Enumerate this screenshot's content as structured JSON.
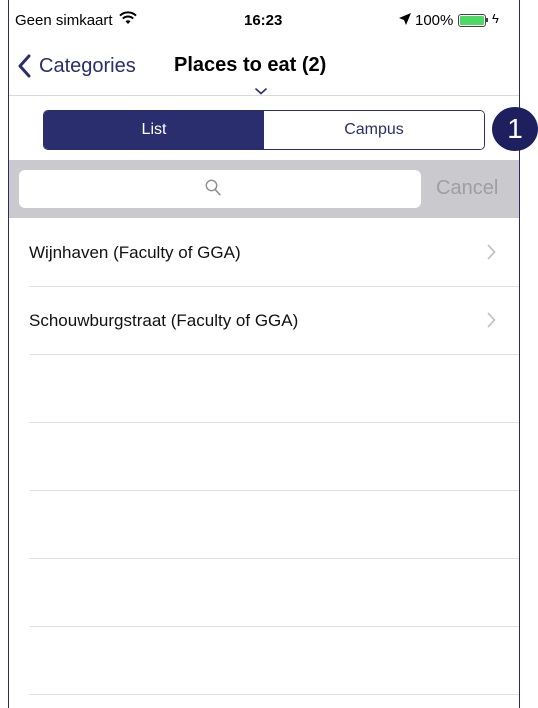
{
  "status": {
    "carrier": "Geen simkaart",
    "time": "16:23",
    "battery": "100%",
    "battery_level": 1.0
  },
  "nav": {
    "back_label": "Categories",
    "title": "Places to eat (2)"
  },
  "segments": [
    {
      "label": "List",
      "active": true
    },
    {
      "label": "Campus",
      "active": false
    }
  ],
  "search": {
    "placeholder": "",
    "cancel_label": "Cancel"
  },
  "list": {
    "items": [
      {
        "label": "Wijnhaven (Faculty of GGA)"
      },
      {
        "label": "Schouwburgstraat (Faculty of GGA)"
      }
    ]
  },
  "annotation": {
    "badge": "1"
  },
  "colors": {
    "accent": "#2b2e6e",
    "badge": "#1d1f5e",
    "search_bg": "#c9c9ce",
    "battery": "#4cd964"
  }
}
